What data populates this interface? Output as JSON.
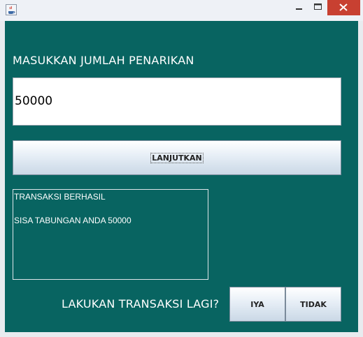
{
  "window": {
    "app_icon": "java-cup-icon",
    "controls": {
      "minimize_icon": "minimize-icon",
      "maximize_icon": "maximize-icon",
      "close_icon": "close-icon",
      "close_color": "#c84031"
    }
  },
  "colors": {
    "panel_background": "#086461",
    "text": "#ffffff"
  },
  "form": {
    "prompt_label": "MASUKKAN JUMLAH PENARIKAN",
    "amount_value": "50000",
    "continue_label": "LANJUTKAN",
    "result_lines": [
      "TRANSAKSI BERHASIL",
      "",
      "SISA TABUNGAN ANDA 50000"
    ],
    "again_question": "LAKUKAN TRANSAKSI LAGI?",
    "yes_label": "IYA",
    "no_label": "TIDAK"
  }
}
